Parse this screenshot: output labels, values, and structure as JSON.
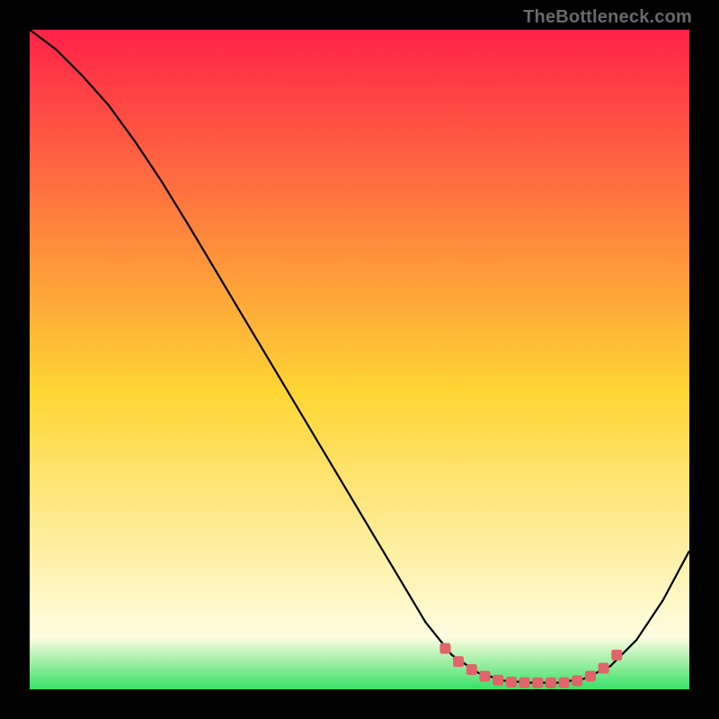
{
  "watermark": "TheBottleneck.com",
  "colors": {
    "bg_black": "#000000",
    "curve_black": "#000000",
    "marker_fill": "#e0646a",
    "marker_stroke": "#e0646a",
    "gradient_top": "#ff2248",
    "gradient_mid": "#ffd633",
    "gradient_low": "#fffde0",
    "gradient_bottom": "#37e166"
  },
  "chart_data": {
    "type": "line",
    "title": "",
    "xlabel": "",
    "ylabel": "",
    "xlim": [
      0,
      100
    ],
    "ylim": [
      0,
      100
    ],
    "grid": false,
    "legend": false,
    "annotations": [
      "TheBottleneck.com"
    ],
    "series": [
      {
        "name": "primary-curve",
        "color": "#000000",
        "x": [
          0,
          4,
          8,
          12,
          16,
          20,
          24,
          28,
          32,
          36,
          40,
          44,
          48,
          52,
          56,
          60,
          64,
          68,
          72,
          76,
          80,
          84,
          88,
          92,
          96,
          100
        ],
        "y": [
          100.0,
          97.0,
          93.0,
          88.5,
          83.0,
          77.0,
          70.5,
          63.8,
          57.1,
          50.4,
          43.7,
          37.0,
          30.3,
          23.6,
          16.9,
          10.2,
          5.2,
          2.5,
          1.3,
          1.0,
          1.0,
          1.6,
          3.5,
          7.5,
          13.5,
          21.0
        ]
      },
      {
        "name": "trough-markers",
        "color": "#e0646a",
        "marker": "square",
        "x": [
          63,
          65,
          67,
          69,
          71,
          73,
          75,
          77,
          79,
          81,
          83,
          85,
          87,
          89
        ],
        "y": [
          6.2,
          4.2,
          3.0,
          2.0,
          1.4,
          1.1,
          1.0,
          1.0,
          1.0,
          1.0,
          1.3,
          2.0,
          3.2,
          5.2
        ]
      }
    ]
  }
}
